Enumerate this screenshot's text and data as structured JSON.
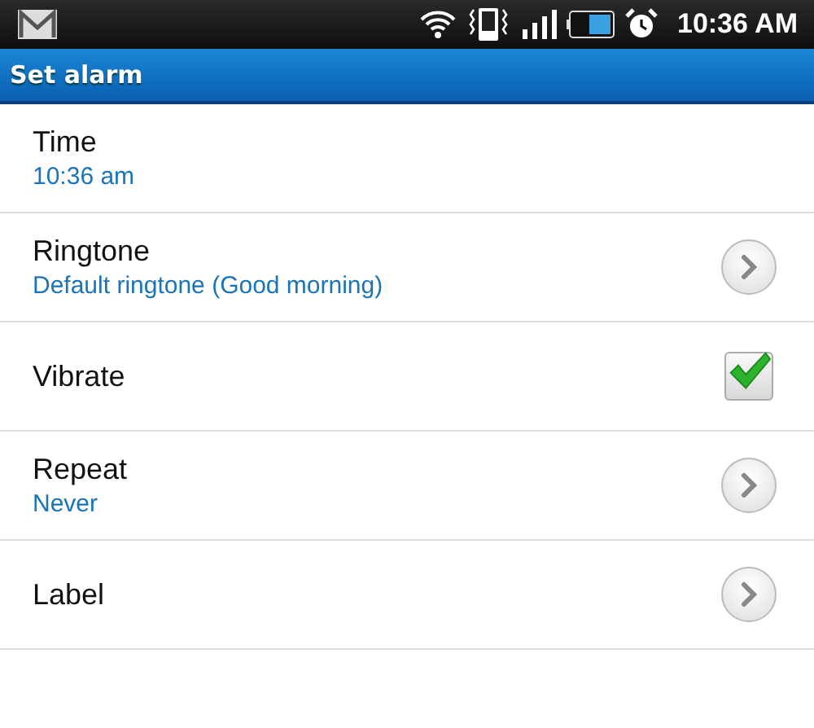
{
  "status_bar": {
    "time": "10:36 AM"
  },
  "title_bar": {
    "title": "Set alarm"
  },
  "settings": [
    {
      "kind": "info",
      "label": "Time",
      "value": "10:36 am"
    },
    {
      "kind": "chevron",
      "label": "Ringtone",
      "value": "Default ringtone (Good morning)"
    },
    {
      "kind": "checkbox",
      "label": "Vibrate",
      "checked": true
    },
    {
      "kind": "chevron",
      "label": "Repeat",
      "value": "Never"
    },
    {
      "kind": "chevron",
      "label": "Label"
    }
  ]
}
